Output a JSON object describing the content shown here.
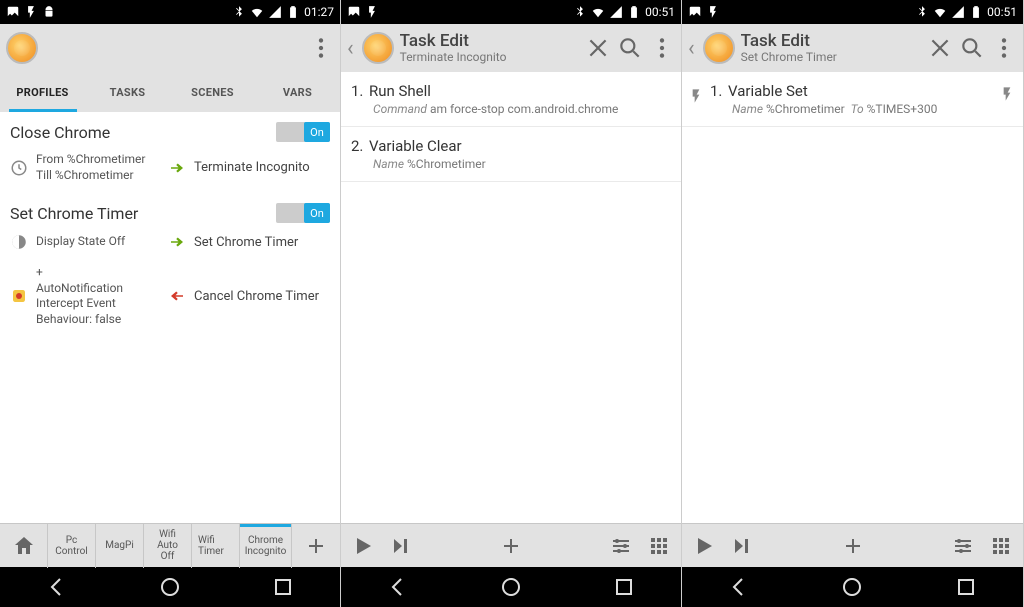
{
  "statusbar": {
    "time1": "01:27",
    "time2": "00:51",
    "time3": "00:51"
  },
  "panel1": {
    "tabs": [
      "PROFILES",
      "TASKS",
      "SCENES",
      "VARS"
    ],
    "activeTab": 0,
    "profiles": [
      {
        "title": "Close Chrome",
        "toggle": "On",
        "rows": [
          {
            "icon": "clock",
            "cond": "From %Chrometimer\nTill %Chrometimer",
            "arrow": "green",
            "task": "Terminate Incognito"
          }
        ]
      },
      {
        "title": "Set Chrome Timer",
        "toggle": "On",
        "rows": [
          {
            "icon": "display",
            "cond": "Display State Off",
            "arrow": "green",
            "task": "Set Chrome Timer"
          },
          {
            "icon": "auto",
            "cond": "+\nAutoNotification Intercept Event Behaviour: false",
            "arrow": "red",
            "task": "Cancel Chrome Timer"
          }
        ]
      }
    ],
    "bottomTabs": [
      "Pc Control",
      "MagPi",
      "Wifi Auto Off",
      "Wifi Timer",
      "Chrome Incognito"
    ],
    "bottomActive": 4
  },
  "panel2": {
    "title": "Task Edit",
    "subtitle": "Terminate Incognito",
    "actions": [
      {
        "num": "1.",
        "name": "Run Shell",
        "detailLabel": "Command",
        "detail": "am force-stop com.android.chrome"
      },
      {
        "num": "2.",
        "name": "Variable Clear",
        "detailLabel": "Name",
        "detail": "%Chrometimer"
      }
    ]
  },
  "panel3": {
    "title": "Task Edit",
    "subtitle": "Set Chrome Timer",
    "actions": [
      {
        "num": "1.",
        "name": "Variable Set",
        "detailLabel": "Name",
        "detail": "%Chrometimer",
        "toLabel": "To",
        "toVal": "%TIMES+300",
        "flash": true
      }
    ]
  }
}
